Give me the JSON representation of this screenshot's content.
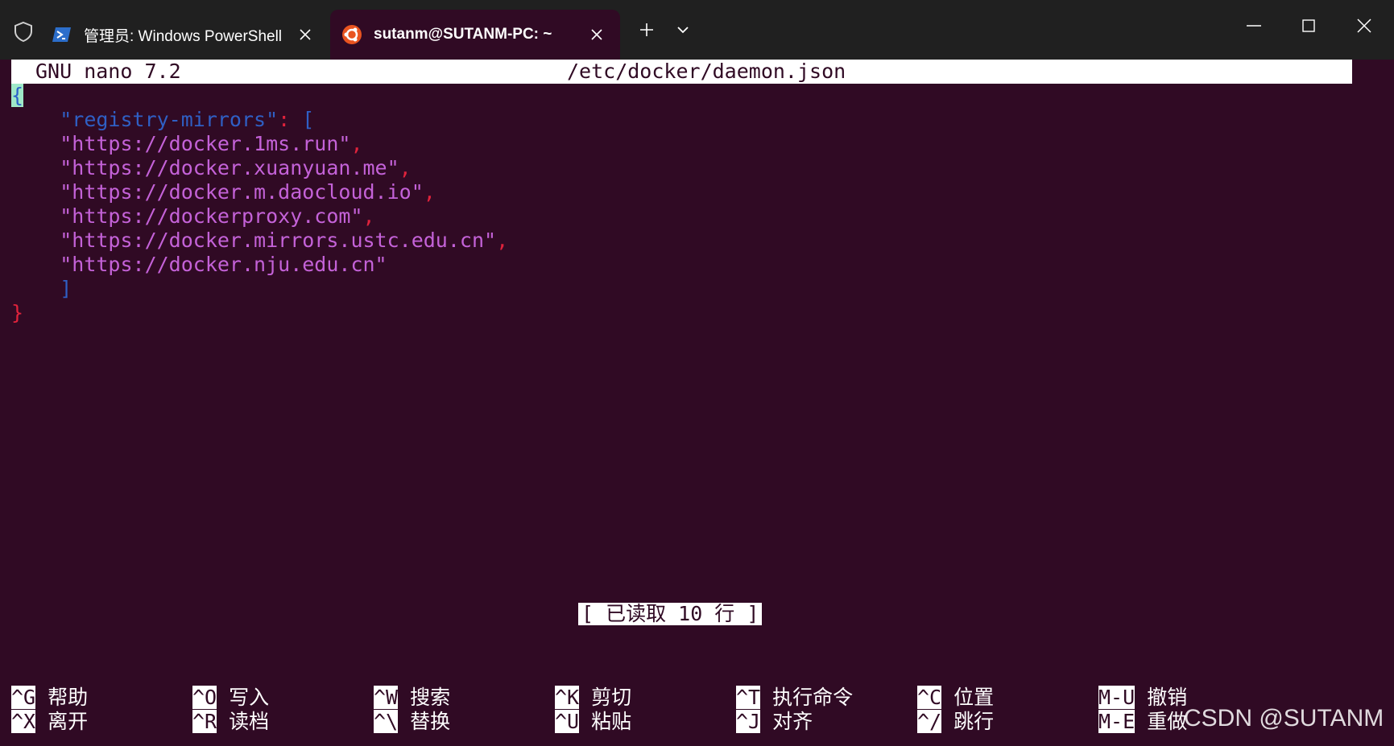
{
  "tabs": [
    {
      "title": "管理员: Windows PowerShell",
      "icon": "powershell-icon",
      "active": false
    },
    {
      "title": "sutanm@SUTANM-PC: ~",
      "icon": "ubuntu-icon",
      "active": true
    }
  ],
  "editor": {
    "app_version": "GNU nano 7.2",
    "file_name": "/etc/docker/daemon.json",
    "lines": {
      "open_brace": "{",
      "key": "\"registry-mirrors\"",
      "colon": ":",
      "open_bracket": "[",
      "mirrors": [
        "\"https://docker.1ms.run\"",
        "\"https://docker.xuanyuan.me\"",
        "\"https://docker.m.daocloud.io\"",
        "\"https://dockerproxy.com\"",
        "\"https://docker.mirrors.ustc.edu.cn\"",
        "\"https://docker.nju.edu.cn\""
      ],
      "comma": ",",
      "close_bracket": "]",
      "close_brace": "}"
    },
    "status_message": "[ 已读取 10 行 ]"
  },
  "shortcuts": [
    {
      "key": "^G",
      "label": "帮助"
    },
    {
      "key": "^O",
      "label": "写入"
    },
    {
      "key": "^W",
      "label": "搜索"
    },
    {
      "key": "^K",
      "label": "剪切"
    },
    {
      "key": "^T",
      "label": "执行命令"
    },
    {
      "key": "^C",
      "label": "位置"
    },
    {
      "key": "M-U",
      "label": "撤销"
    },
    {
      "key": "^X",
      "label": "离开"
    },
    {
      "key": "^R",
      "label": "读档"
    },
    {
      "key": "^\\",
      "label": "替换"
    },
    {
      "key": "^U",
      "label": "粘贴"
    },
    {
      "key": "^J",
      "label": "对齐"
    },
    {
      "key": "^/",
      "label": "跳行"
    },
    {
      "key": "M-E",
      "label": "重做"
    }
  ],
  "watermark": "CSDN @SUTANM",
  "colors": {
    "terminal_bg": "#300a24",
    "tabbar_bg": "#202020",
    "json_key": "#2f5fc4",
    "json_string": "#c462d8",
    "json_punct": "#e0233c"
  }
}
